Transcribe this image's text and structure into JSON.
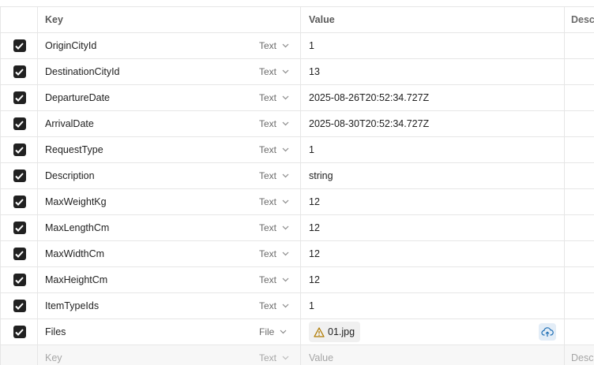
{
  "header": {
    "key": "Key",
    "value": "Value",
    "description": "Desc"
  },
  "rows": [
    {
      "key": "OriginCityId",
      "type": "Text",
      "value": "1"
    },
    {
      "key": "DestinationCityId",
      "type": "Text",
      "value": "13"
    },
    {
      "key": "DepartureDate",
      "type": "Text",
      "value": "2025-08-26T20:52:34.727Z"
    },
    {
      "key": "ArrivalDate",
      "type": "Text",
      "value": "2025-08-30T20:52:34.727Z"
    },
    {
      "key": "RequestType",
      "type": "Text",
      "value": "1"
    },
    {
      "key": "Description",
      "type": "Text",
      "value": "string"
    },
    {
      "key": "MaxWeightKg",
      "type": "Text",
      "value": "12"
    },
    {
      "key": "MaxLengthCm",
      "type": "Text",
      "value": "12"
    },
    {
      "key": "MaxWidthCm",
      "type": "Text",
      "value": "12"
    },
    {
      "key": "MaxHeightCm",
      "type": "Text",
      "value": "12"
    },
    {
      "key": "ItemTypeIds",
      "type": "Text",
      "value": "1"
    }
  ],
  "file_row": {
    "key": "Files",
    "type": "File",
    "file_name": "01.jpg",
    "warning_icon": "warning-triangle-icon",
    "upload_icon": "cloud-upload-icon"
  },
  "placeholder_row": {
    "key": "Key",
    "type": "Text",
    "value": "Value",
    "description": "Desc"
  },
  "colors": {
    "checkbox": "#212121",
    "warning": "#b07a00",
    "upload_accent": "#1f6fb5"
  }
}
